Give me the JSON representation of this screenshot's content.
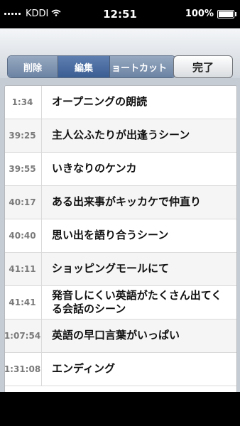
{
  "status": {
    "carrier": "KDDI",
    "time": "12:51",
    "battery": "100%"
  },
  "toolbar": {
    "segments": [
      "削除",
      "編集",
      "ョートカット"
    ],
    "done_label": "完了"
  },
  "rows": [
    {
      "time": "1:34",
      "label": "オープニングの朗読"
    },
    {
      "time": "39:25",
      "label": "主人公ふたりが出逢うシーン"
    },
    {
      "time": "39:55",
      "label": "いきなりのケンカ"
    },
    {
      "time": "40:17",
      "label": "ある出来事がキッカケで仲直り"
    },
    {
      "time": "40:40",
      "label": "思い出を語り合うシーン"
    },
    {
      "time": "41:11",
      "label": "ショッピングモールにて"
    },
    {
      "time": "41:41",
      "label": "発音しにくい英語がたくさん出てくる会話のシーン"
    },
    {
      "time": "1:07:54",
      "label": "英語の早口言葉がいっぱい"
    },
    {
      "time": "1:31:08",
      "label": "エンディング"
    }
  ]
}
